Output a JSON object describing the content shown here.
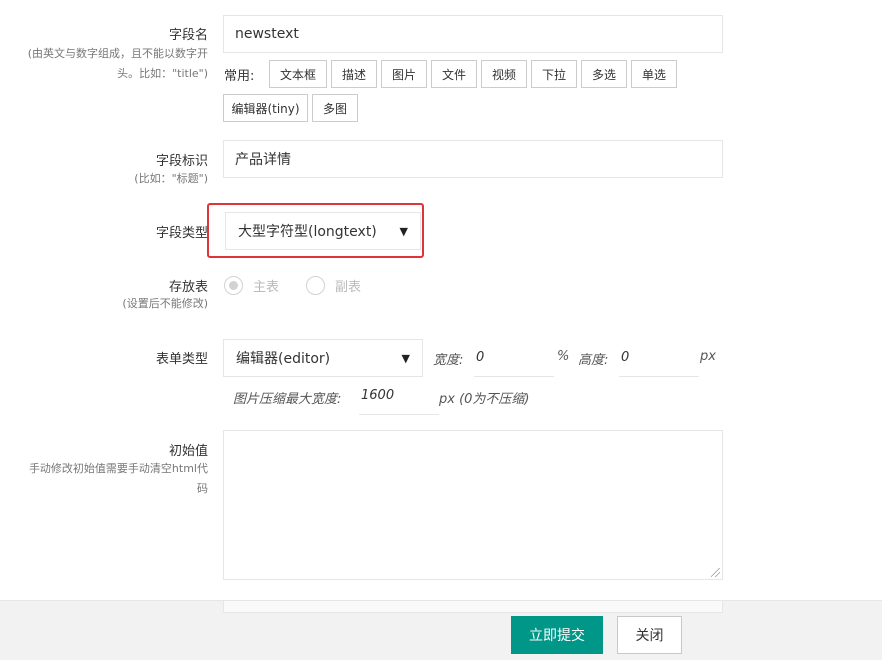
{
  "field_name": {
    "label": "字段名",
    "help": [
      "(由英文与数字组成，且不能以数字开",
      "头。比如：\"title\")"
    ],
    "value": "newstext",
    "common_label": "常用:",
    "presets": [
      "文本框",
      "描述",
      "图片",
      "文件",
      "视频",
      "下拉",
      "多选",
      "单选",
      "编辑器(tiny)",
      "多图"
    ]
  },
  "field_title": {
    "label": "字段标识",
    "help": "(比如：\"标题\")",
    "value": "产品详情"
  },
  "field_type": {
    "label": "字段类型",
    "selected": "大型字符型(longtext)",
    "highlight_color": "#e0343a"
  },
  "storage_table": {
    "label": "存放表",
    "help": "(设置后不能修改)",
    "options": [
      "主表",
      "副表"
    ],
    "selected": "主表"
  },
  "form_type": {
    "label": "表单类型",
    "selected": "编辑器(editor)",
    "width_label": "宽度:",
    "width_value": "0",
    "width_unit": "%",
    "height_label": "高度:",
    "height_value": "0",
    "height_unit": "px",
    "compress_label": "图片压缩最大宽度:",
    "compress_value": "1600",
    "compress_unit": "px (0为不压缩)"
  },
  "initial_value": {
    "label": "初始值",
    "help": [
      "手动修改初始值需要手动清空html代",
      "码"
    ],
    "value": ""
  },
  "footer": {
    "submit": "立即提交",
    "close": "关闭",
    "primary_color": "#009688"
  }
}
